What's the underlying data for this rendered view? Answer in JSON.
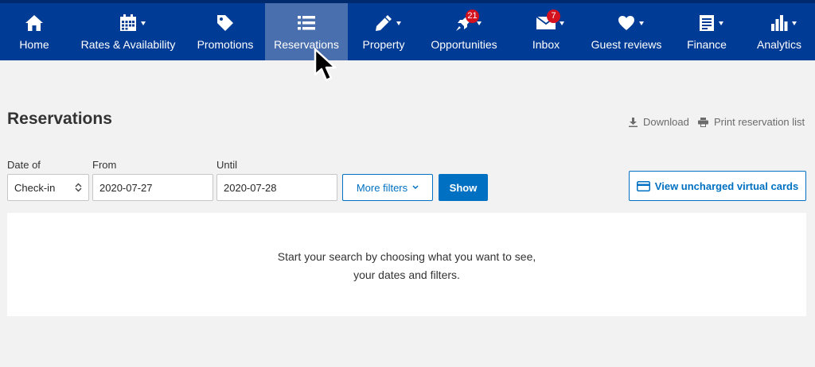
{
  "nav": {
    "items": [
      {
        "label": "Home",
        "icon": "home-icon"
      },
      {
        "label": "Rates & Availability",
        "icon": "calendar-icon"
      },
      {
        "label": "Promotions",
        "icon": "tag-icon"
      },
      {
        "label": "Reservations",
        "icon": "list-icon",
        "active": true
      },
      {
        "label": "Property",
        "icon": "pencil-icon"
      },
      {
        "label": "Opportunities",
        "icon": "rocket-icon",
        "badge": "21"
      },
      {
        "label": "Inbox",
        "icon": "envelope-icon",
        "badge": "7"
      },
      {
        "label": "Guest reviews",
        "icon": "heart-icon"
      },
      {
        "label": "Finance",
        "icon": "invoice-icon"
      },
      {
        "label": "Analytics",
        "icon": "bar-chart-icon"
      }
    ]
  },
  "page": {
    "title": "Reservations",
    "download_label": "Download",
    "print_label": "Print reservation list"
  },
  "filters": {
    "date_of_label": "Date of",
    "date_of_value": "Check-in",
    "from_label": "From",
    "from_value": "2020-07-27",
    "until_label": "Until",
    "until_value": "2020-07-28",
    "more_filters_label": "More filters",
    "show_label": "Show",
    "virtual_cards_label": "View uncharged virtual cards"
  },
  "results": {
    "empty_line1": "Start your search by choosing what you want to see,",
    "empty_line2": "your dates and filters."
  },
  "colors": {
    "nav_bg": "#003b95",
    "nav_active": "#4a6fae",
    "primary": "#0071c2",
    "badge": "#d4111e"
  }
}
